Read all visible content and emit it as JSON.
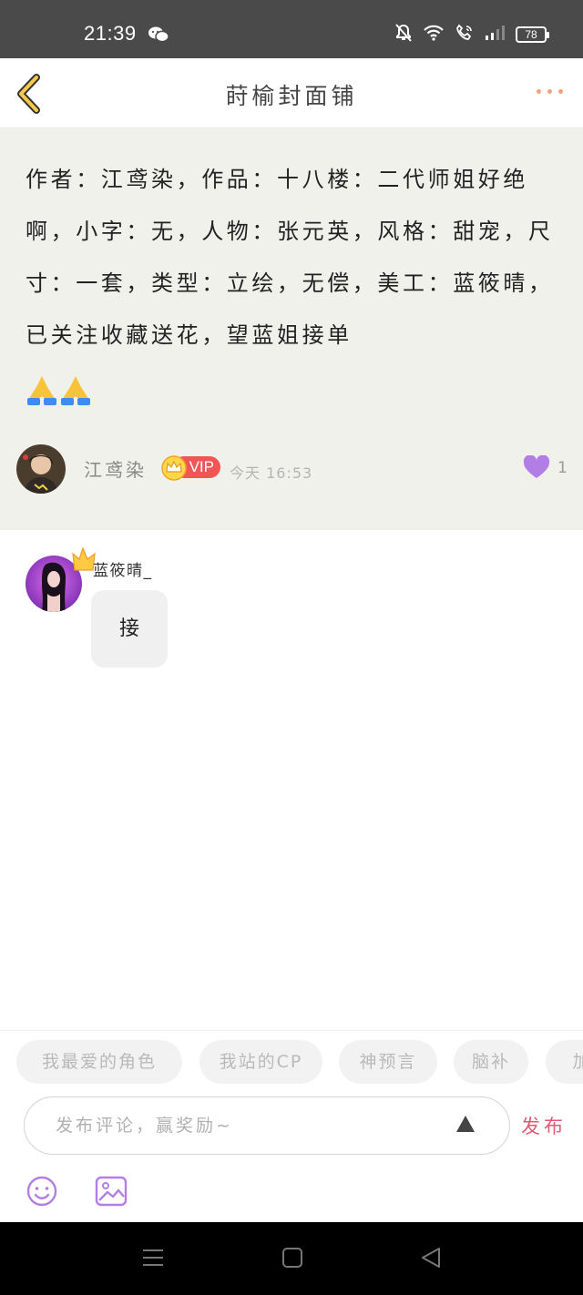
{
  "status_bar": {
    "time": "21:39",
    "battery": "78",
    "icons": [
      "wechat-icon",
      "mute-bell-icon",
      "wifi-icon",
      "call-icon",
      "signal-icon",
      "battery-icon"
    ]
  },
  "header": {
    "title": "莳榆封面铺",
    "back_icon": "chevron-left-icon",
    "more_icon": "more-dots-icon"
  },
  "post": {
    "text": "作者：江鸢染，作品：十八楼：二代师姐好绝啊，小字：无，人物：张元英，风格：甜宠，尺寸：一套，类型：立绘，无偿，美工：蓝筱晴，已关注收藏送花，望蓝姐接单",
    "emoji": "🙏🙏",
    "author": "江鸢染",
    "vip_label": "VIP",
    "time": "今天 16:53",
    "likes": "1"
  },
  "comment": {
    "user": "蓝筱晴_",
    "text": "接"
  },
  "tags": [
    "我最爱的角色",
    "我站的CP",
    "神预言",
    "脑补",
    "加"
  ],
  "input": {
    "placeholder": "发布评论，赢奖励~",
    "value": "",
    "publish_label": "发布"
  },
  "colors": {
    "accent": "#e45a73",
    "vip_red": "#f05656",
    "like_purple": "#b27ee6",
    "post_bg": "#f1f1ec",
    "back_yellow": "#f6c94a"
  }
}
